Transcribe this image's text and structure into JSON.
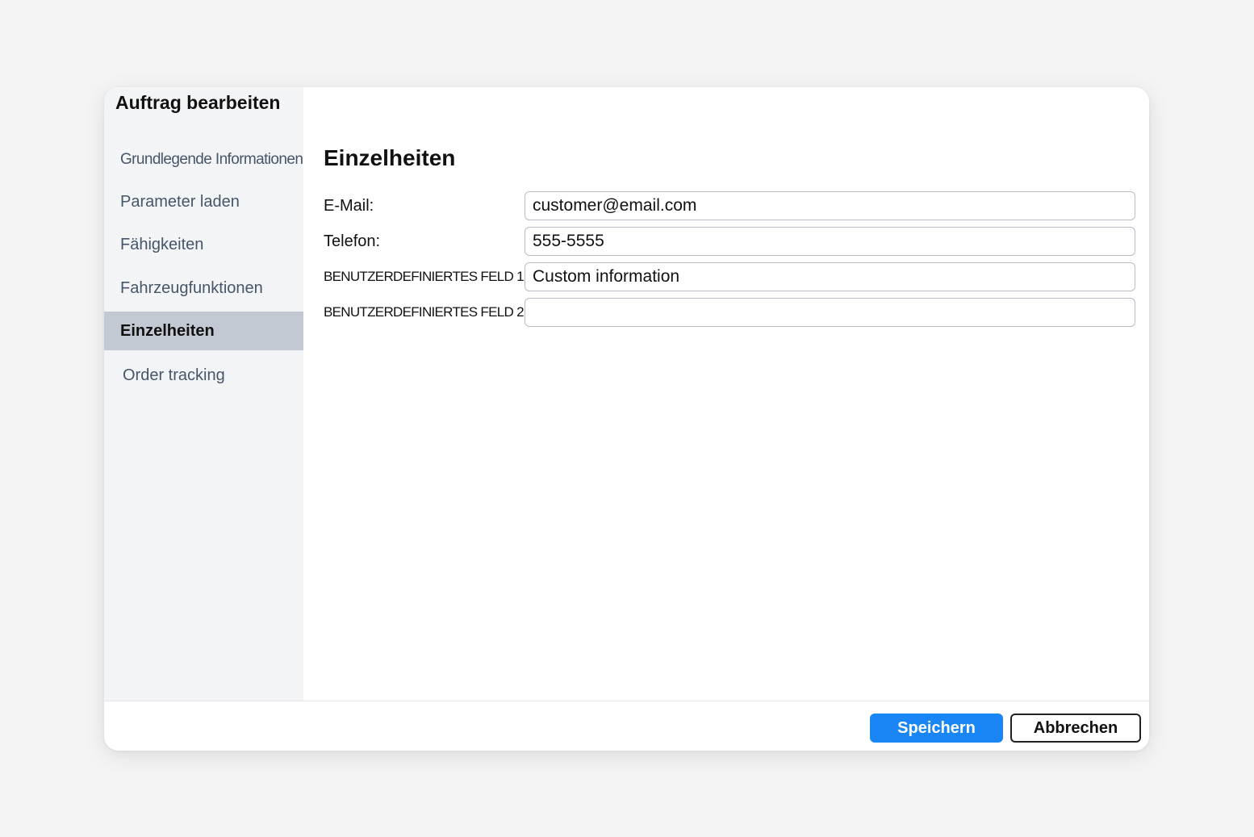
{
  "dialog": {
    "title": "Auftrag bearbeiten"
  },
  "sidebar": {
    "items": [
      {
        "label": "Grundlegende Informationen",
        "active": false
      },
      {
        "label": "Parameter laden",
        "active": false
      },
      {
        "label": "Fähigkeiten",
        "active": false
      },
      {
        "label": "Fahrzeugfunktionen",
        "active": false
      },
      {
        "label": "Einzelheiten",
        "active": true
      },
      {
        "label": "Order tracking",
        "active": false
      }
    ]
  },
  "main": {
    "section_title": "Einzelheiten",
    "fields": [
      {
        "label": "E-Mail:",
        "value": "customer@email.com"
      },
      {
        "label": "Telefon:",
        "value": "555-5555"
      },
      {
        "label": "BENUTZERDEFINIERTES FELD 1:",
        "value": "Custom information"
      },
      {
        "label": "BENUTZERDEFINIERTES FELD 2:",
        "value": ""
      }
    ]
  },
  "footer": {
    "save_label": "Speichern",
    "cancel_label": "Abbrechen"
  },
  "colors": {
    "primary": "#1a86f5",
    "sidebar_active": "#c3c9d2",
    "sidebar_bg": "#f3f4f6"
  }
}
